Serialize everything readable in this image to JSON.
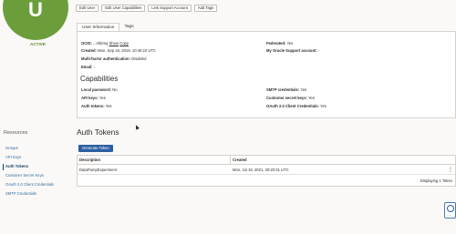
{
  "user": {
    "avatar_letter": "U",
    "status": "ACTIVE"
  },
  "actions": [
    "Edit User",
    "Edit User Capabilities",
    "Link Support Account",
    "Add Tags"
  ],
  "tabs": [
    "User Information",
    "Tags"
  ],
  "info": {
    "ocid_label": "OCID:",
    "ocid_value": "...rrkkmq",
    "show": "Show",
    "copy": "Copy",
    "created_label": "Created:",
    "created_value": "Mon, Sep 16, 2019, 10:40:22 UTC",
    "mfa_label": "Multi-factor authentication:",
    "mfa_value": "Disabled",
    "email_label": "Email:",
    "email_value": "-",
    "federated_label": "Federated:",
    "federated_value": "Yes",
    "support_label": "My Oracle Support account:",
    "support_value": "-"
  },
  "capabilities": {
    "title": "Capabilities",
    "local_password_label": "Local password:",
    "local_password_value": "No",
    "api_keys_label": "API keys:",
    "api_keys_value": "Yes",
    "auth_tokens_label": "Auth tokens:",
    "auth_tokens_value": "Yes",
    "smtp_label": "SMTP credentials:",
    "smtp_value": "Yes",
    "customer_secret_label": "Customer secret keys:",
    "customer_secret_value": "Yes",
    "oauth_label": "OAuth 2.0 Client Credentials:",
    "oauth_value": "Yes"
  },
  "resources": {
    "title": "Resources",
    "items": [
      "Groups",
      "API Keys",
      "Auth Tokens",
      "Customer Secret Keys",
      "OAuth 2.0 Client Credentials",
      "SMTP Credentials"
    ],
    "active": "Auth Tokens"
  },
  "auth_tokens": {
    "title": "Auth Tokens",
    "generate_label": "Generate Token",
    "columns": [
      "Description",
      "Created"
    ],
    "rows": [
      {
        "description": "DataPumpExperiment",
        "created": "Mon, Jul 19, 2021, 20:20:31 UTC"
      }
    ],
    "footer": "Displaying 1 Token"
  },
  "colors": {
    "avatar": "#6b9e3a",
    "primary_button": "#2c5ea0",
    "link": "#2f6ea0"
  },
  "icons": {
    "row_menu": "kebab-menu-icon",
    "help": "help-lifebuoy-icon"
  }
}
